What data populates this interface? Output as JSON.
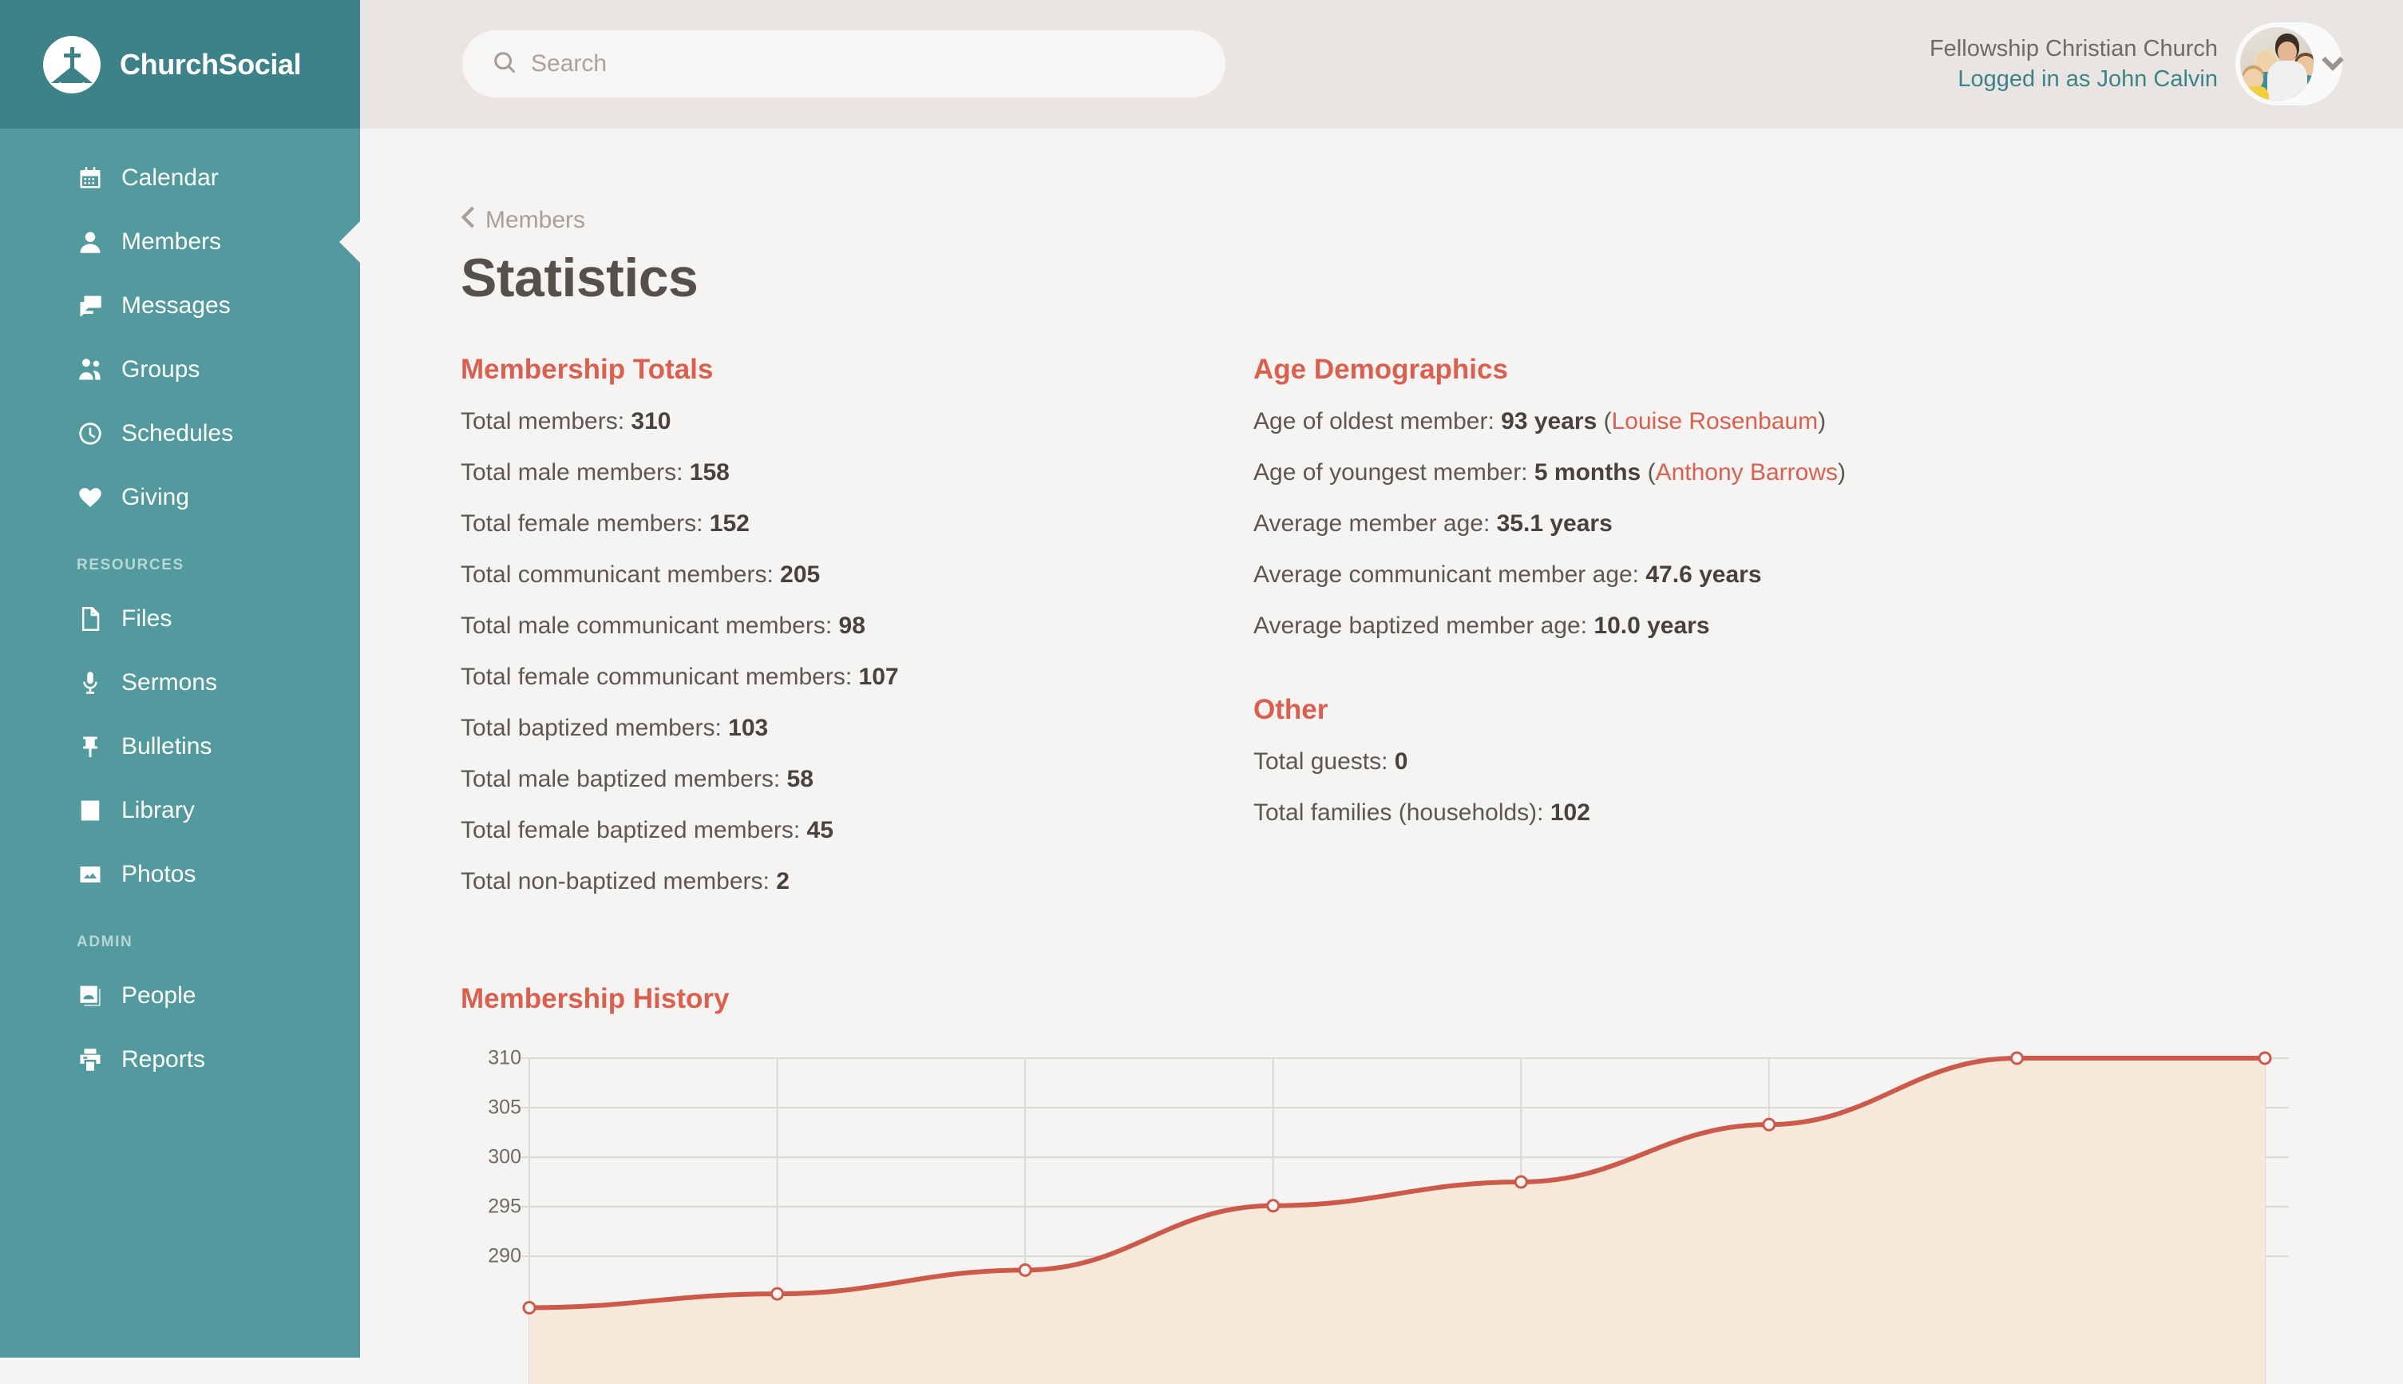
{
  "brand": {
    "name": "ChurchSocial",
    "logo_icon": "church-cross-logo-icon"
  },
  "sidebar": {
    "main_items": [
      {
        "label": "Calendar",
        "icon": "calendar-icon",
        "active": false
      },
      {
        "label": "Members",
        "icon": "person-icon",
        "active": true
      },
      {
        "label": "Messages",
        "icon": "chat-bubbles-icon",
        "active": false
      },
      {
        "label": "Groups",
        "icon": "people-group-icon",
        "active": false
      },
      {
        "label": "Schedules",
        "icon": "clock-icon",
        "active": false
      },
      {
        "label": "Giving",
        "icon": "heart-icon",
        "active": false
      }
    ],
    "resources_label": "RESOURCES",
    "resources_items": [
      {
        "label": "Files",
        "icon": "file-document-icon"
      },
      {
        "label": "Sermons",
        "icon": "microphone-icon"
      },
      {
        "label": "Bulletins",
        "icon": "pushpin-icon"
      },
      {
        "label": "Library",
        "icon": "book-icon"
      },
      {
        "label": "Photos",
        "icon": "image-icon"
      }
    ],
    "admin_label": "ADMIN",
    "admin_items": [
      {
        "label": "People",
        "icon": "contact-card-icon"
      },
      {
        "label": "Reports",
        "icon": "printer-icon"
      }
    ]
  },
  "topbar": {
    "search": {
      "placeholder": "Search",
      "value": "",
      "icon": "search-icon"
    },
    "account": {
      "church": "Fellowship Christian Church",
      "logged_in_as": "Logged in as John Calvin",
      "avatar_icon": "family-photo-avatar",
      "chevron_icon": "chevron-down-icon"
    }
  },
  "page": {
    "breadcrumb": "Members",
    "breadcrumb_icon": "chevron-left-icon",
    "title": "Statistics"
  },
  "membership_totals": {
    "heading": "Membership Totals",
    "rows": [
      {
        "label": "Total members:",
        "value": "310"
      },
      {
        "label": "Total male members:",
        "value": "158"
      },
      {
        "label": "Total female members:",
        "value": "152"
      },
      {
        "label": "Total communicant members:",
        "value": "205"
      },
      {
        "label": "Total male communicant members:",
        "value": "98"
      },
      {
        "label": "Total female communicant members:",
        "value": "107"
      },
      {
        "label": "Total baptized members:",
        "value": "103"
      },
      {
        "label": "Total male baptized members:",
        "value": "58"
      },
      {
        "label": "Total female baptized members:",
        "value": "45"
      },
      {
        "label": "Total non-baptized members:",
        "value": "2"
      }
    ]
  },
  "age_demographics": {
    "heading": "Age Demographics",
    "rows": [
      {
        "label": "Age of oldest member:",
        "value": "93 years",
        "link": "Louise Rosenbaum"
      },
      {
        "label": "Age of youngest member:",
        "value": "5 months",
        "link": "Anthony Barrows"
      },
      {
        "label": "Average member age:",
        "value": "35.1 years",
        "link": ""
      },
      {
        "label": "Average communicant member age:",
        "value": "47.6 years",
        "link": ""
      },
      {
        "label": "Average baptized member age:",
        "value": "10.0 years",
        "link": ""
      }
    ]
  },
  "other": {
    "heading": "Other",
    "rows": [
      {
        "label": "Total guests:",
        "value": "0"
      },
      {
        "label": "Total families (households):",
        "value": "102"
      }
    ]
  },
  "chart_data": {
    "type": "area",
    "title": "Membership History",
    "xlabel": "",
    "ylabel": "",
    "ylim": [
      285,
      311
    ],
    "yticks": [
      310,
      305,
      300,
      295,
      290
    ],
    "grid": true,
    "legend": false,
    "series": [
      {
        "name": "Total members",
        "values": [
          284.8,
          286.2,
          288.6,
          295.1,
          297.5,
          303.3,
          310,
          310
        ]
      }
    ],
    "x": [
      0,
      1,
      2,
      3,
      4,
      5,
      6,
      7
    ],
    "line_color": "#cb5a4b",
    "fill_color": "#f6e9da",
    "marker": "open-circle",
    "note": "Chart is cropped by the bottom edge of the viewport; x-axis tick labels are not visible."
  },
  "colors": {
    "sidebar": "#529a9d",
    "sidebar_header": "#3d8288",
    "accent_red": "#d9604f",
    "accent_teal": "#3d8288",
    "page_bg": "#f5f4f2",
    "topbar_bg": "#e8e5e2"
  }
}
